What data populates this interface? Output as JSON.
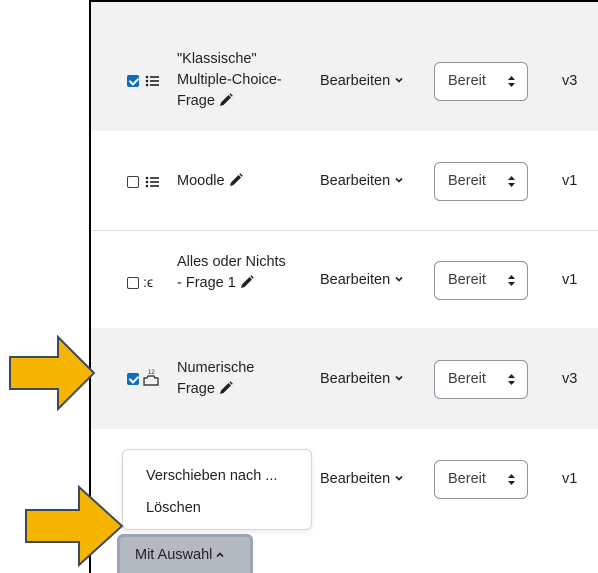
{
  "questions": [
    {
      "name": "\"Klassische\" Multiple-Choice-Frage",
      "lines": [
        "\"Klassische\"",
        "Multiple-Choice-",
        "Frage"
      ],
      "checked": true,
      "icon": "multichoice-icon",
      "glyph": "☰",
      "edit": "Bearbeiten",
      "status": "Bereit",
      "version": "v3"
    },
    {
      "name": "Moodle",
      "lines": [
        "Moodle"
      ],
      "checked": false,
      "icon": "multichoice-icon",
      "glyph": "☰",
      "edit": "Bearbeiten",
      "status": "Bereit",
      "version": "v1"
    },
    {
      "name": "Alles oder Nichts - Frage 1",
      "lines": [
        "Alles oder Nichts",
        "- Frage 1"
      ],
      "checked": false,
      "icon": "multianswer-icon",
      "glyph": ":ϵ",
      "edit": "Bearbeiten",
      "status": "Bereit",
      "version": "v1"
    },
    {
      "name": "Numerische Frage",
      "lines": [
        "Numerische",
        "Frage"
      ],
      "checked": true,
      "icon": "numerical-icon",
      "glyph": "¹²",
      "edit": "Bearbeiten",
      "status": "Bereit",
      "version": "v3"
    },
    {
      "name": "",
      "lines": [],
      "checked": false,
      "icon": "",
      "glyph": "",
      "edit": "Bearbeiten",
      "status": "Bereit",
      "version": "v1"
    }
  ],
  "bulk_menu": {
    "items": [
      "Verschieben nach ...",
      "Löschen"
    ],
    "button_label": "Mit Auswahl"
  },
  "colors": {
    "accent": "#0f6cbf",
    "callout_arrow": "#f5b400",
    "row_shade": "#f2f2f2"
  }
}
